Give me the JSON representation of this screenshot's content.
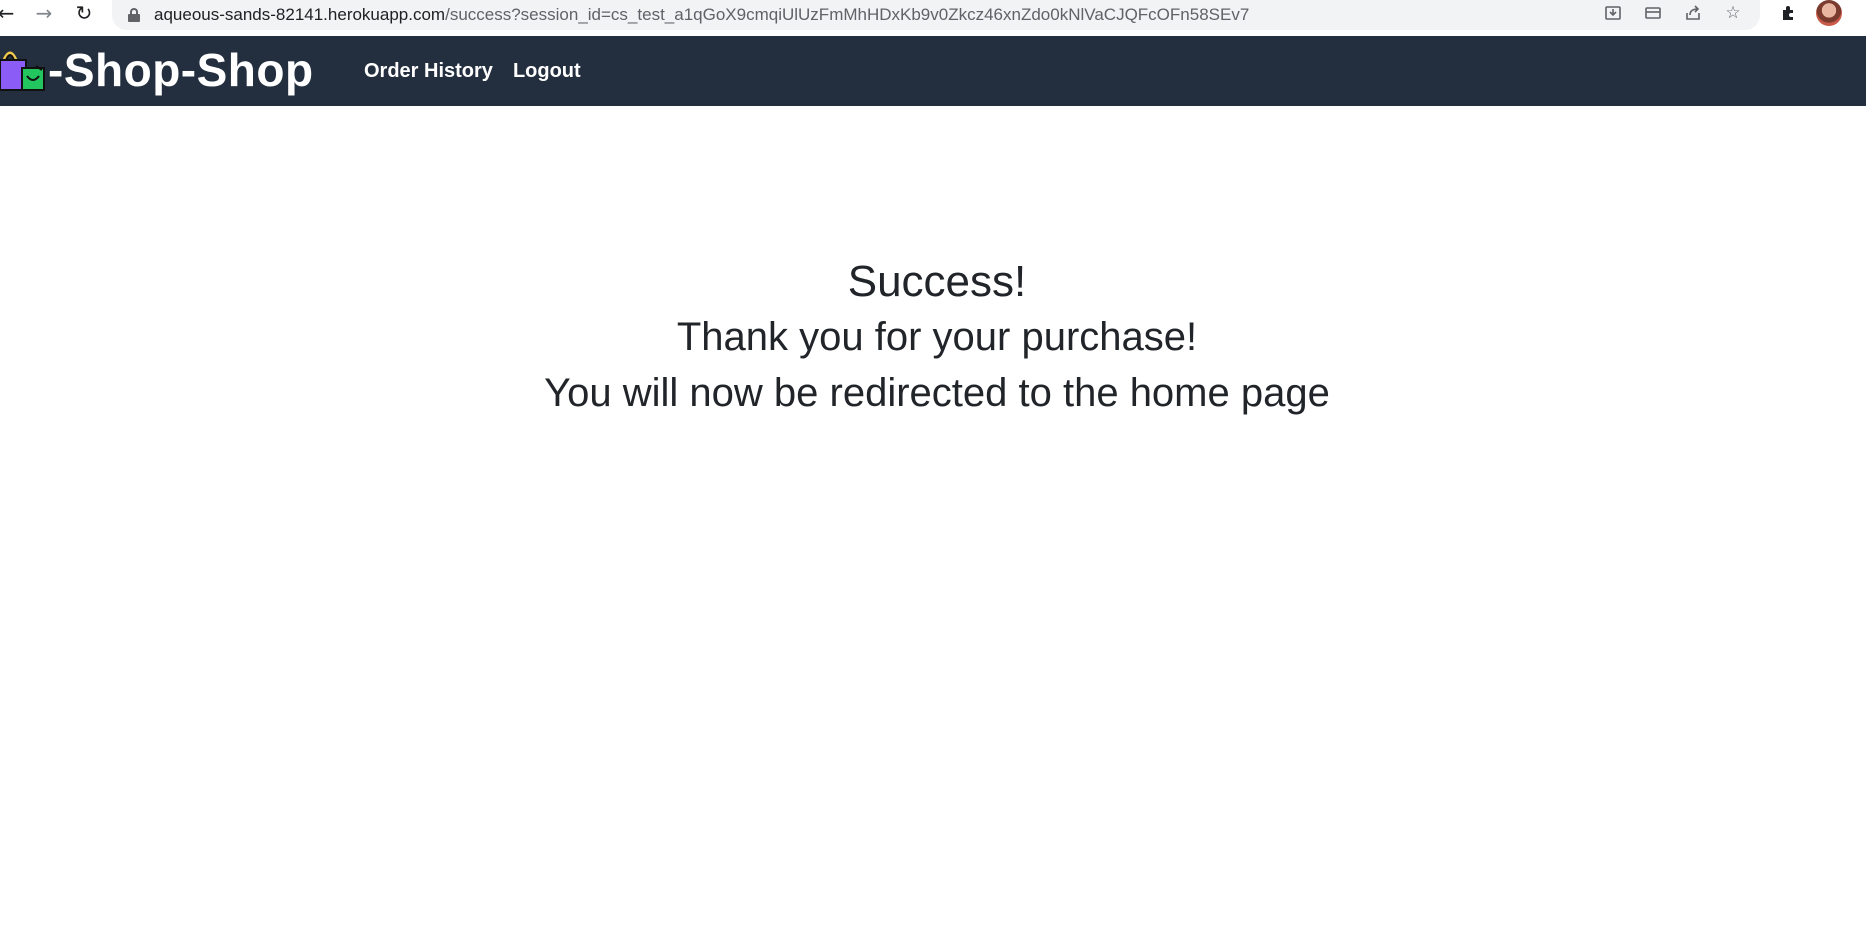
{
  "browser": {
    "url_host": "aqueous-sands-82141.herokuapp.com",
    "url_path": "/success?session_id=cs_test_a1qGoX9cmqiUlUzFmMhHDxKb9v0Zkcz46xnZdo0kNlVaCJQFcOFn58SEv7",
    "icons": [
      "back-icon",
      "forward-icon",
      "reload-icon",
      "lock-icon",
      "install-icon",
      "tab-search-icon",
      "share-icon",
      "bookmark-star-icon",
      "extensions-icon",
      "profile-avatar"
    ]
  },
  "app": {
    "brand": "-Shop-Shop",
    "nav_color": "#232f3e",
    "nav": {
      "order_history": "Order History",
      "logout": "Logout"
    }
  },
  "message": {
    "title": "Success!",
    "line1": "Thank you for your purchase!",
    "line2": "You will now be redirected to the home page"
  }
}
